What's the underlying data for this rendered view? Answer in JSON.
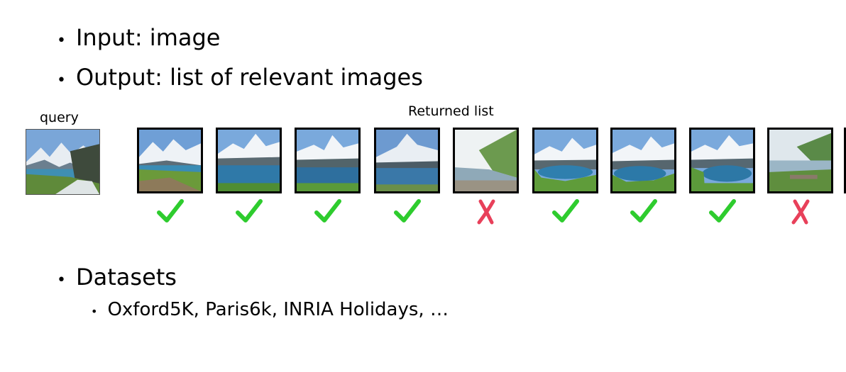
{
  "bullets": {
    "input": "Input: image",
    "output": "Output: list of relevant images",
    "datasets": "Datasets",
    "datasets_list": "Oxford5K, Paris6k, INRIA Holidays, …"
  },
  "labels": {
    "query": "query",
    "returned_list": "Returned list"
  },
  "results": [
    {
      "relevant": true
    },
    {
      "relevant": true
    },
    {
      "relevant": true
    },
    {
      "relevant": true
    },
    {
      "relevant": false
    },
    {
      "relevant": true
    },
    {
      "relevant": true
    },
    {
      "relevant": true
    },
    {
      "relevant": false
    }
  ],
  "colors": {
    "check": "#2ecc2e",
    "cross": "#e8405a"
  }
}
